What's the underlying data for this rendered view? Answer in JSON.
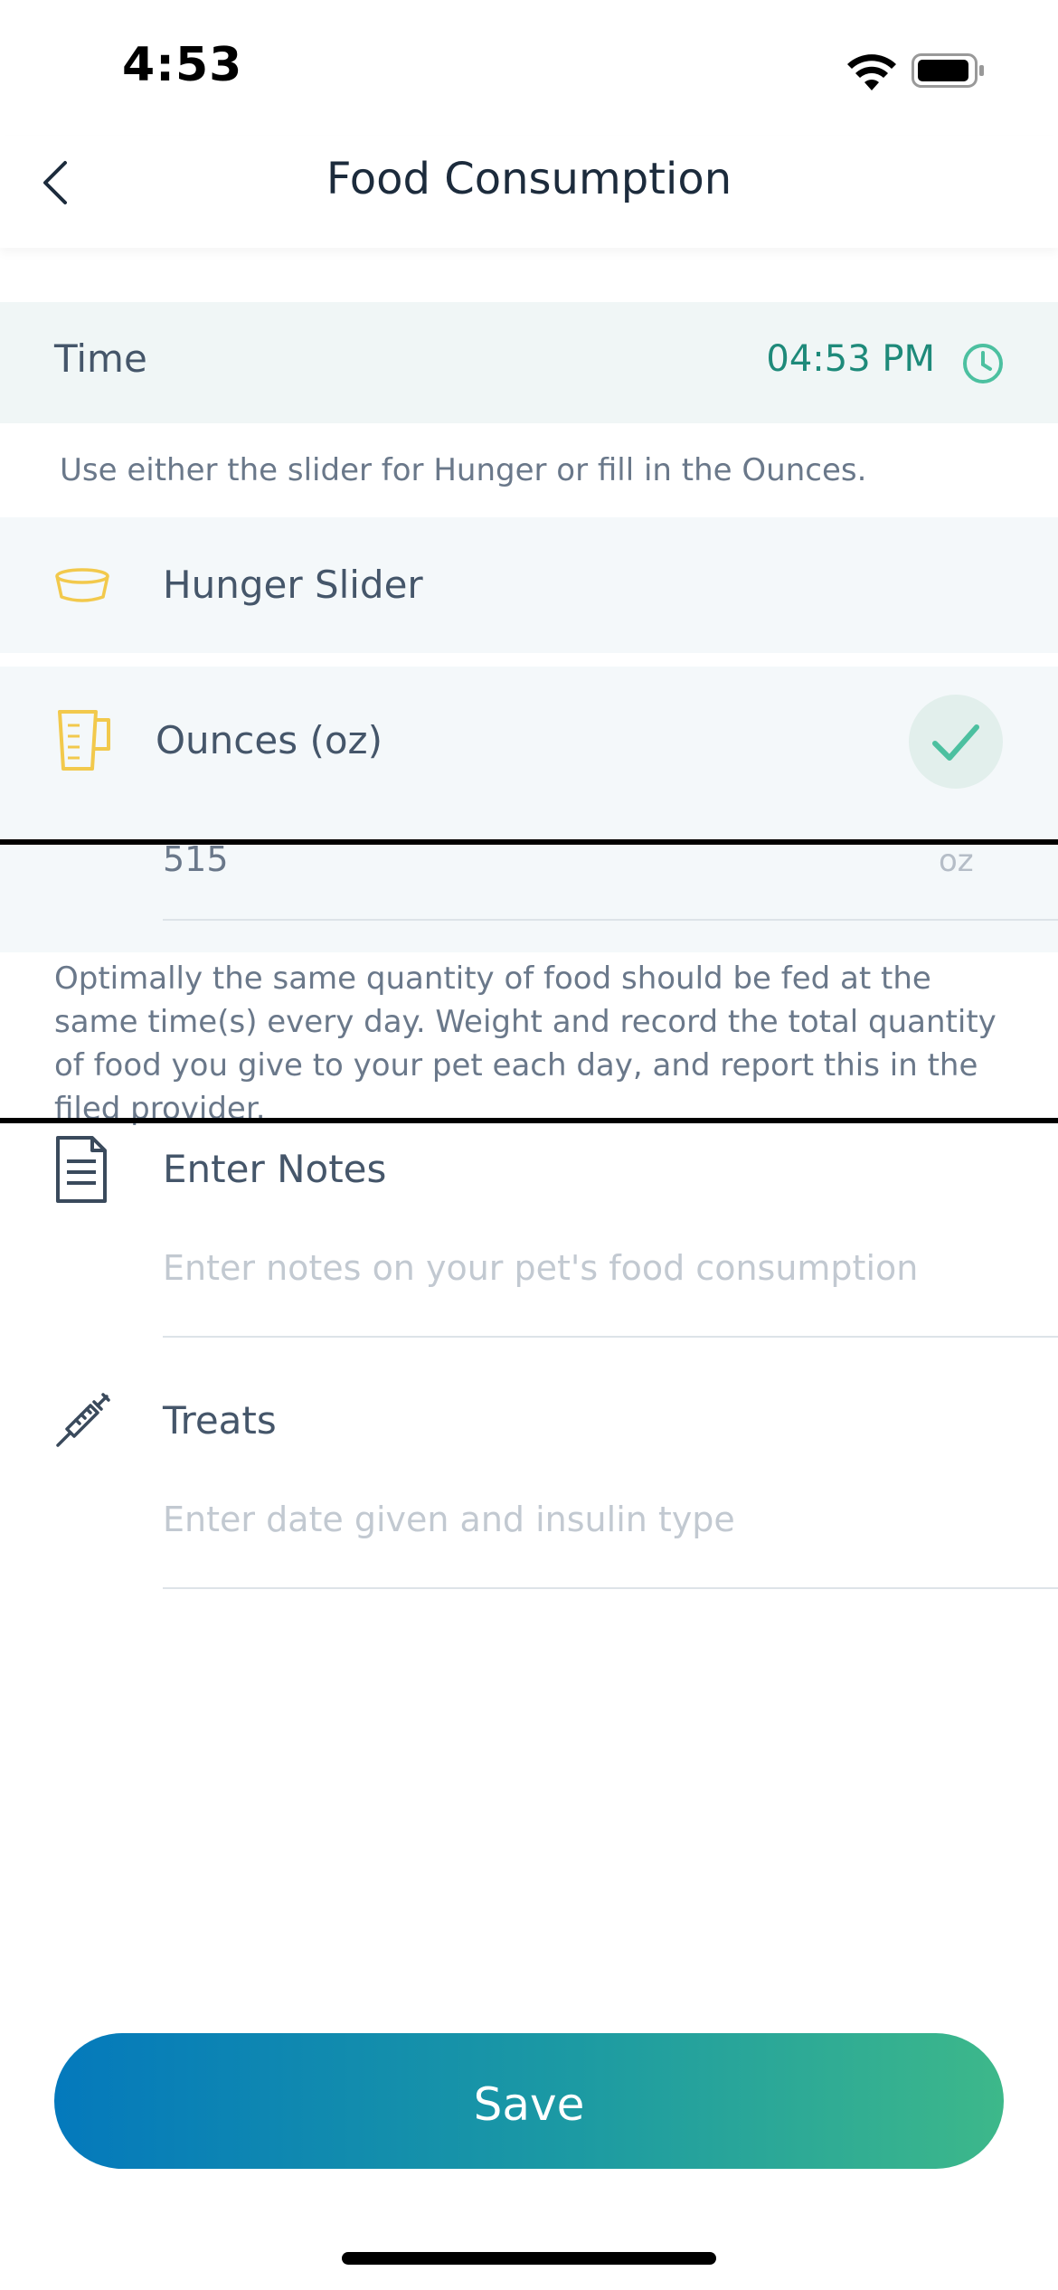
{
  "status_bar": {
    "time": "4:53"
  },
  "nav": {
    "title": "Food Consumption"
  },
  "time_row": {
    "label": "Time",
    "value": "04:53 PM"
  },
  "hint": "Use either the slider for Hunger or fill in the Ounces.",
  "options": {
    "hunger_label": "Hunger Slider",
    "ounces_label": "Ounces (oz)",
    "ounces_selected": true
  },
  "ounces_input": {
    "value": "515",
    "unit": "oz"
  },
  "info_text": "Optimally the same quantity of food should be fed at the same time(s) every day. Weight and record the total quantity of food you give to your pet each day, and report this in the filed provider.",
  "notes": {
    "label": "Enter Notes",
    "placeholder": "Enter notes on your pet's food consumption"
  },
  "treats": {
    "label": "Treats",
    "placeholder": "Enter date given and insulin type"
  },
  "save_label": "Save",
  "colors": {
    "accent": "#1e8a7a",
    "icon_yellow": "#f2c94c",
    "gradient_start": "#0479bc",
    "gradient_end": "#3db88a"
  },
  "icons": [
    "back-icon",
    "clock-icon",
    "bowl-icon",
    "jug-icon",
    "check-icon",
    "notes-icon",
    "syringe-icon",
    "wifi-icon",
    "battery-icon"
  ]
}
